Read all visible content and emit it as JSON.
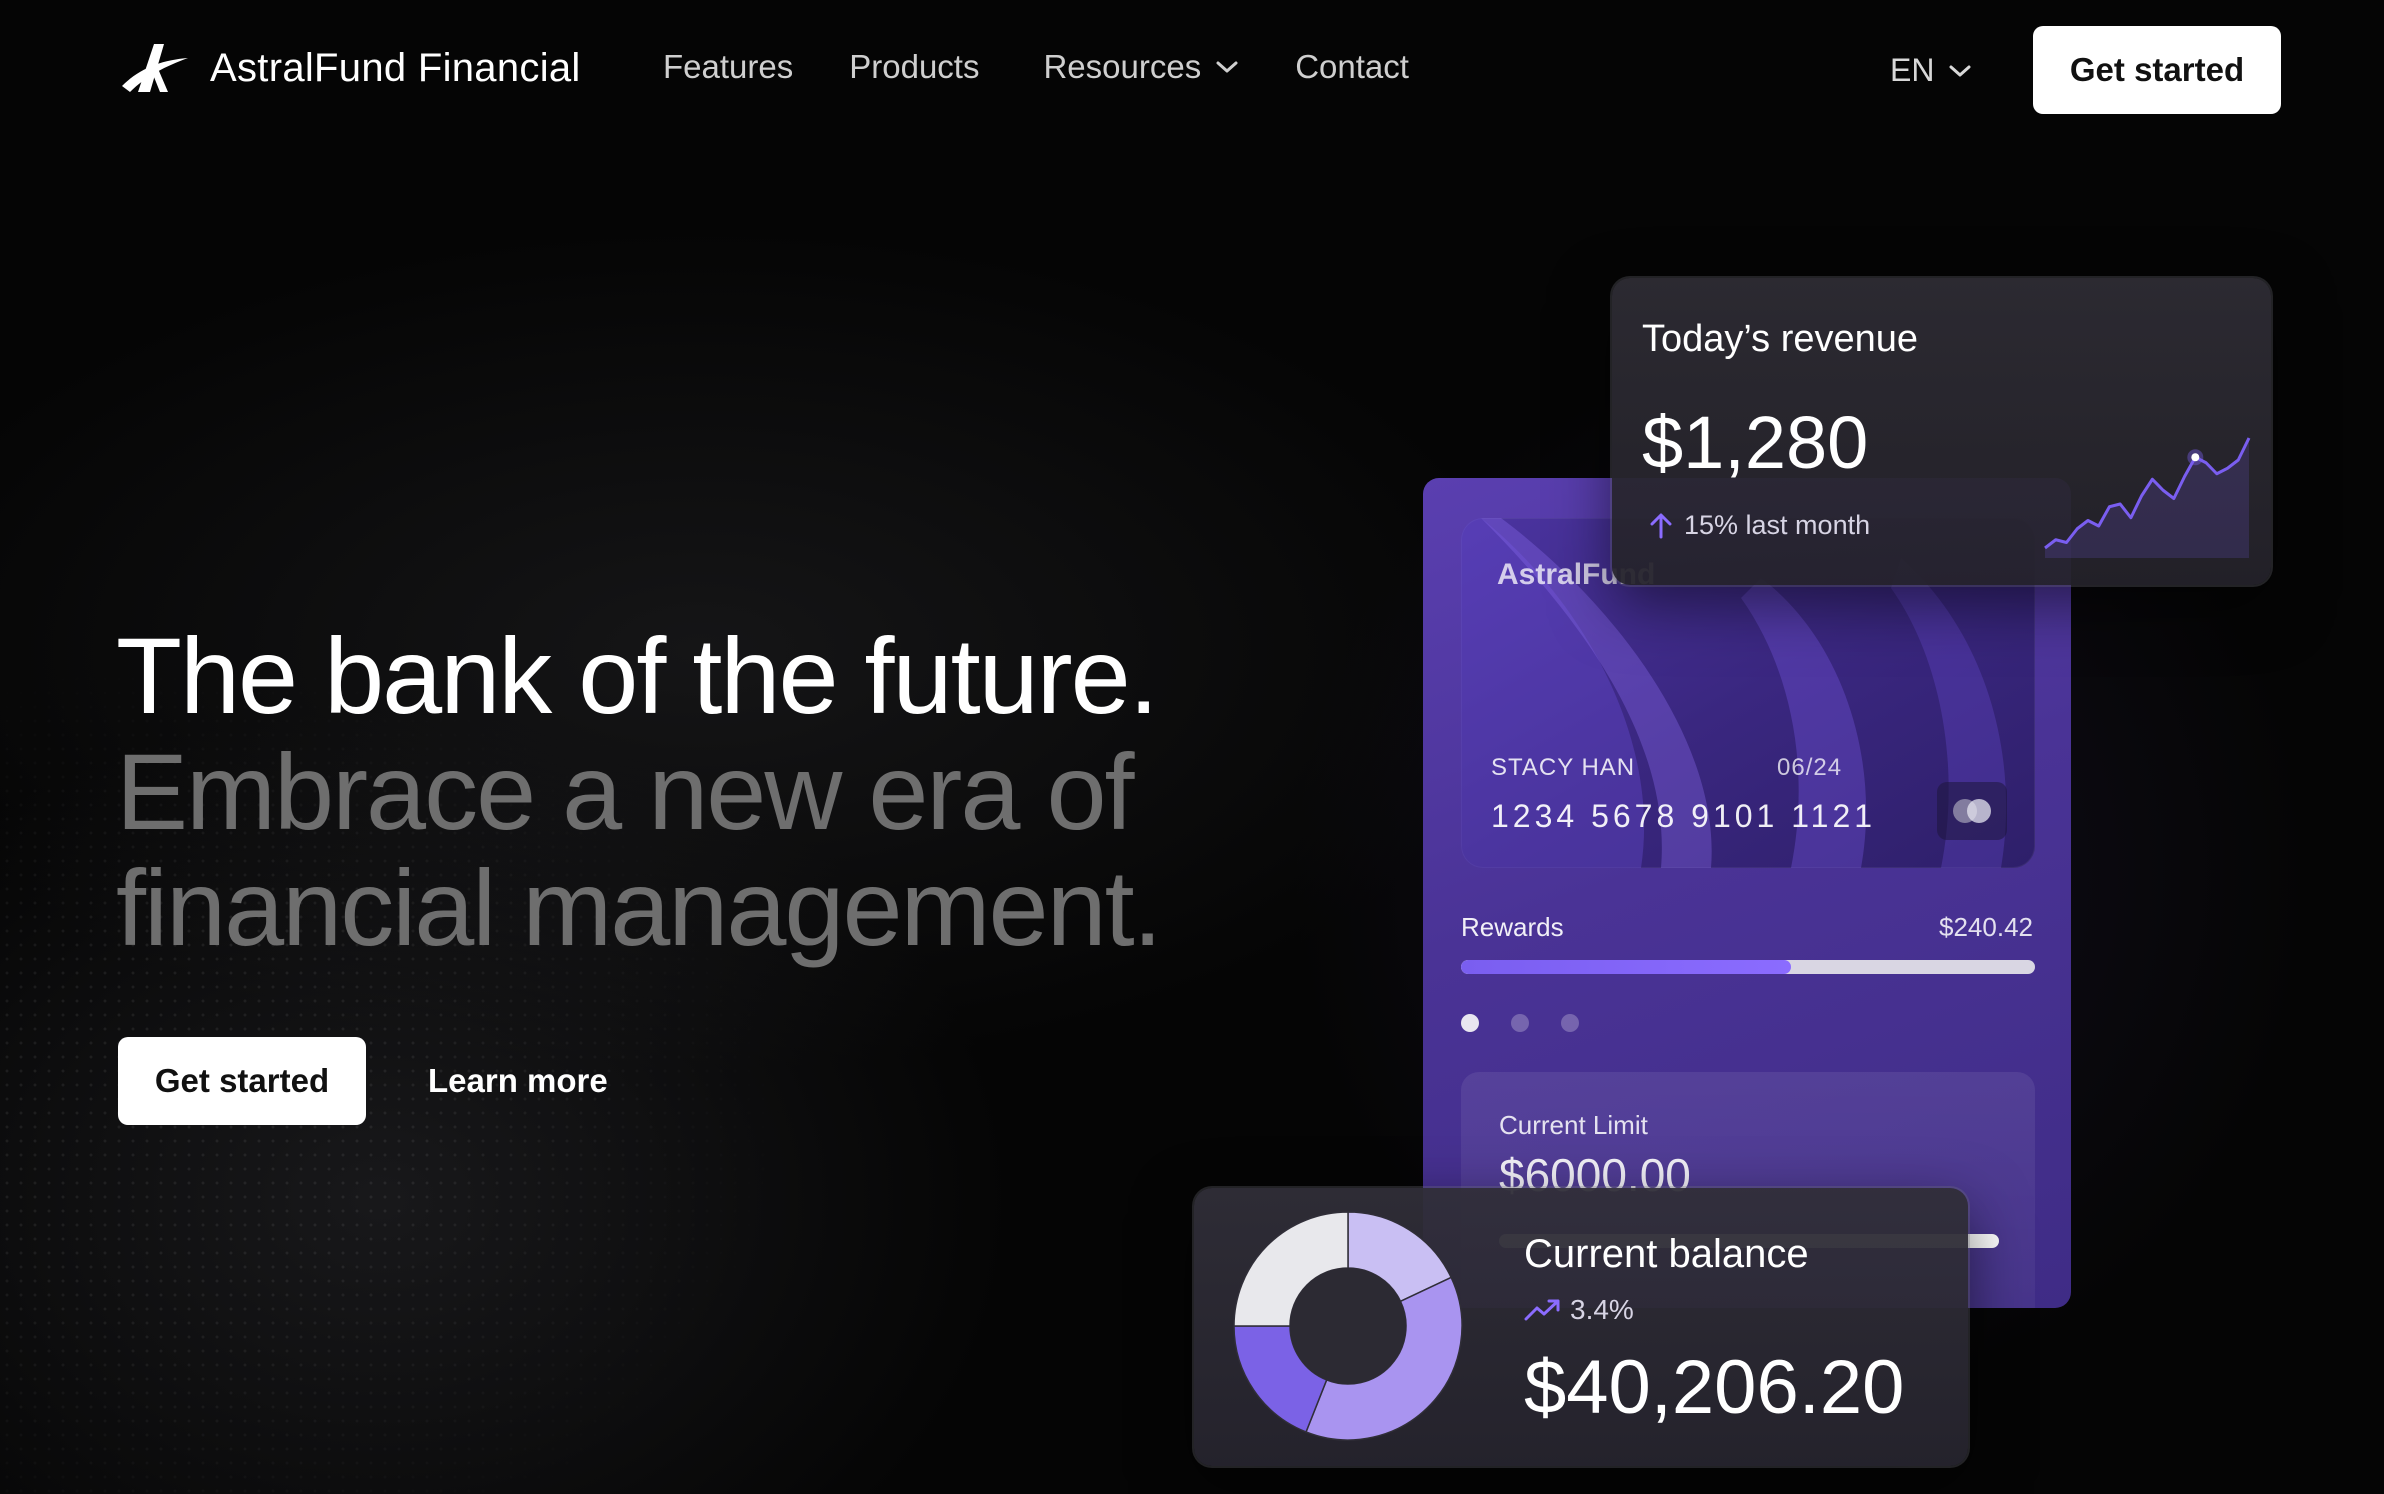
{
  "nav": {
    "brand": "AstralFund Financial",
    "links": [
      "Features",
      "Products",
      "Resources",
      "Contact"
    ],
    "language": "EN",
    "cta": "Get started"
  },
  "hero": {
    "headline": "The bank of the future.",
    "subline_1": "Embrace a new era of",
    "subline_2": "financial management.",
    "cta_primary": "Get started",
    "cta_secondary": "Learn more"
  },
  "revenue_card": {
    "title": "Today’s revenue",
    "value": "$1,280",
    "change": "15% last month",
    "sparkline": [
      8,
      14,
      12,
      22,
      28,
      24,
      38,
      40,
      30,
      46,
      58,
      50,
      44,
      60,
      74,
      70,
      62,
      66,
      72,
      88
    ]
  },
  "credit_card": {
    "brand": "AstralFund",
    "holder": "STACY HAN",
    "expiry": "06/24",
    "number": "1234  5678  9101  1121"
  },
  "rewards": {
    "label": "Rewards",
    "value": "$240.42",
    "progress": 0.575,
    "pager_count": 3,
    "pager_active": 0
  },
  "limit": {
    "label": "Current Limit",
    "value": "$6000.00"
  },
  "balance_card": {
    "title": "Current balance",
    "change": "3.4%",
    "value": "$40,206.20",
    "donut": [
      {
        "share": 0.18,
        "color": "#c9bff3"
      },
      {
        "share": 0.38,
        "color": "#a994f0"
      },
      {
        "share": 0.19,
        "color": "#7b62e6"
      },
      {
        "share": 0.25,
        "color": "#e8e8ec"
      }
    ]
  },
  "colors": {
    "background": "#050505",
    "accent": "#7a5ef0",
    "panel_purple": "#4a3396"
  }
}
